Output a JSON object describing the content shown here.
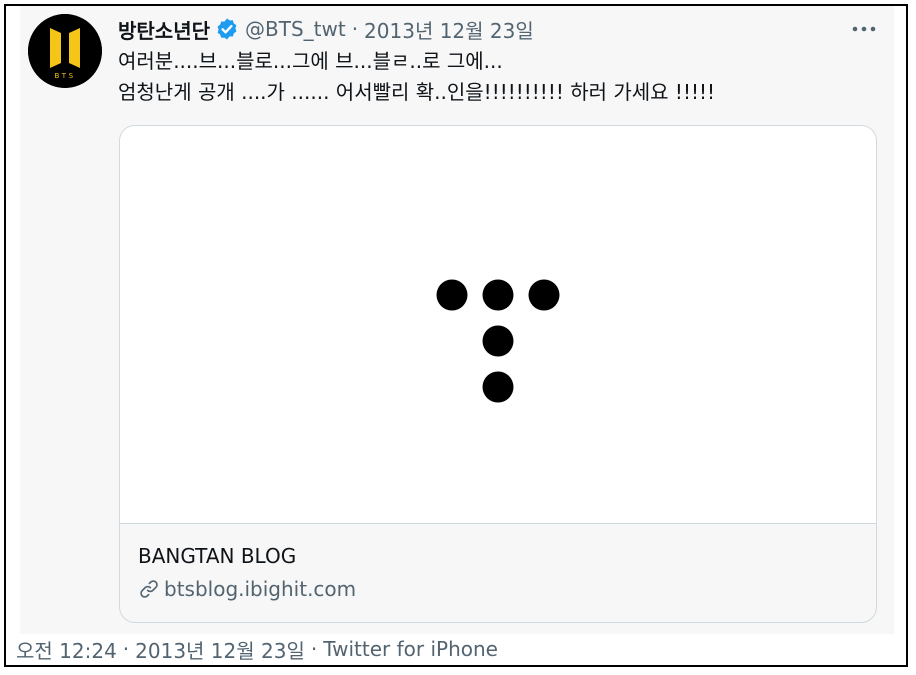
{
  "tweet": {
    "display_name": "방탄소년단",
    "handle": "@BTS_twt",
    "separator": "·",
    "date": "2013년 12월 23일",
    "text_lines": [
      "여러분....브...블로...그에 브...블ㄹ..로 그에...",
      "엄청난게 공개 ....가 ...... 어서빨리 확..인을!!!!!!!!!! 하러 가세요 !!!!!"
    ],
    "avatar": {
      "icon": "bts-logo-icon",
      "logo_text": "BTS",
      "background": "#000000",
      "accent": "#f5c518"
    },
    "verified_icon": "verified-badge-icon",
    "verified_color": "#1d9bf0",
    "more_icon": "more-dots-icon"
  },
  "card": {
    "media_icon": "bighit-dots-logo-icon",
    "title": "BANGTAN BLOG",
    "link_icon": "link-icon",
    "url": "btsblog.ibighit.com"
  },
  "footer": {
    "time": "오전 12:24",
    "separator1": "·",
    "date": "2013년 12월 23일",
    "separator2": "·",
    "source": "Twitter for iPhone"
  }
}
